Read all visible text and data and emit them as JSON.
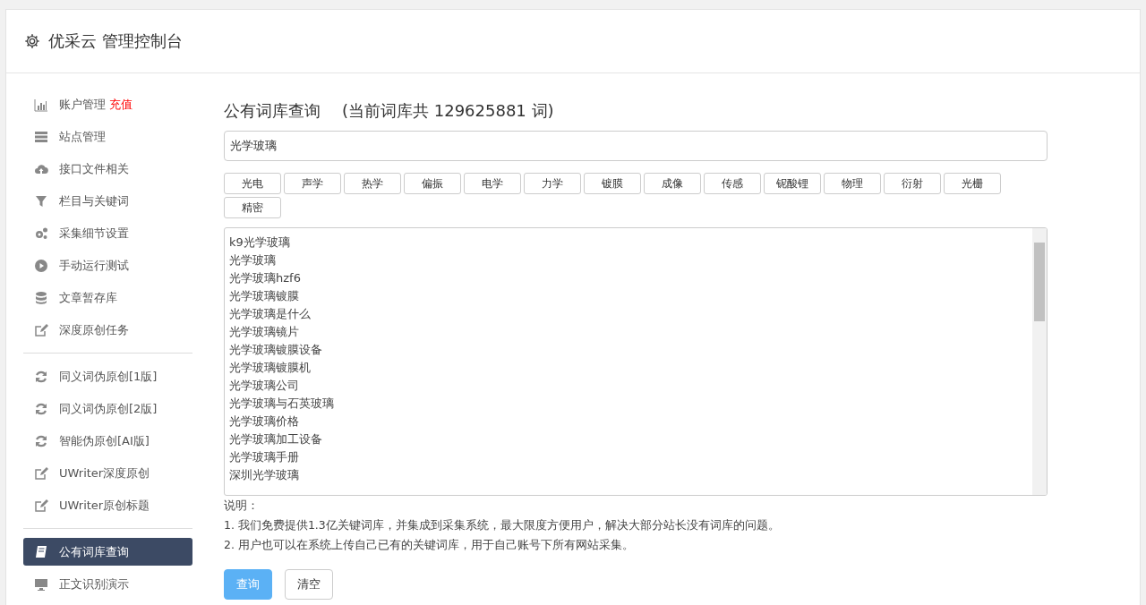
{
  "header": {
    "title": "优采云 管理控制台"
  },
  "sidebar": {
    "groups": [
      {
        "items": [
          {
            "kind": "chart",
            "label": "账户管理",
            "badge": "充值",
            "selected": false
          },
          {
            "kind": "server",
            "label": "站点管理",
            "selected": false
          },
          {
            "kind": "cloud",
            "label": "接口文件相关",
            "selected": false
          },
          {
            "kind": "filter",
            "label": "栏目与关键词",
            "selected": false
          },
          {
            "kind": "gears",
            "label": "采集细节设置",
            "selected": false
          },
          {
            "kind": "play",
            "label": "手动运行测试",
            "selected": false
          },
          {
            "kind": "database",
            "label": "文章暂存库",
            "selected": false
          },
          {
            "kind": "edit",
            "label": "深度原创任务",
            "selected": false
          }
        ]
      },
      {
        "items": [
          {
            "kind": "refresh",
            "label": "同义词伪原创[1版]",
            "selected": false
          },
          {
            "kind": "refresh",
            "label": "同义词伪原创[2版]",
            "selected": false
          },
          {
            "kind": "refresh",
            "label": "智能伪原创[AI版]",
            "selected": false
          },
          {
            "kind": "edit",
            "label": "UWriter深度原创",
            "selected": false
          },
          {
            "kind": "edit",
            "label": "UWriter原创标题",
            "selected": false
          }
        ]
      },
      {
        "items": [
          {
            "kind": "book",
            "label": "公有词库查询",
            "selected": true
          },
          {
            "kind": "monitor",
            "label": "正文识别演示",
            "selected": false
          }
        ]
      }
    ]
  },
  "main": {
    "title": "公有词库查询",
    "count_text": "(当前词库共 129625881 词)",
    "search": {
      "value": "光学玻璃"
    },
    "tags": [
      "光电",
      "声学",
      "热学",
      "偏振",
      "电学",
      "力学",
      "镀膜",
      "成像",
      "传感",
      "铌酸锂",
      "物理",
      "衍射",
      "光栅",
      "精密"
    ],
    "results": [
      "k9光学玻璃",
      "光学玻璃",
      "光学玻璃hzf6",
      "光学玻璃镀膜",
      "光学玻璃是什么",
      "光学玻璃镜片",
      "光学玻璃镀膜设备",
      "光学玻璃镀膜机",
      "光学玻璃公司",
      "光学玻璃与石英玻璃",
      "光学玻璃价格",
      "光学玻璃加工设备",
      "光学玻璃手册",
      "深圳光学玻璃"
    ],
    "notes_title": "说明：",
    "notes": [
      "1. 我们免费提供1.3亿关键词库，并集成到采集系统，最大限度方便用户，解决大部分站长没有词库的问题。",
      "2. 用户也可以在系统上传自己已有的关键词库，用于自己账号下所有网站采集。"
    ],
    "buttons": [
      {
        "label": "查询",
        "primary": true
      },
      {
        "label": "清空",
        "primary": false
      }
    ]
  }
}
